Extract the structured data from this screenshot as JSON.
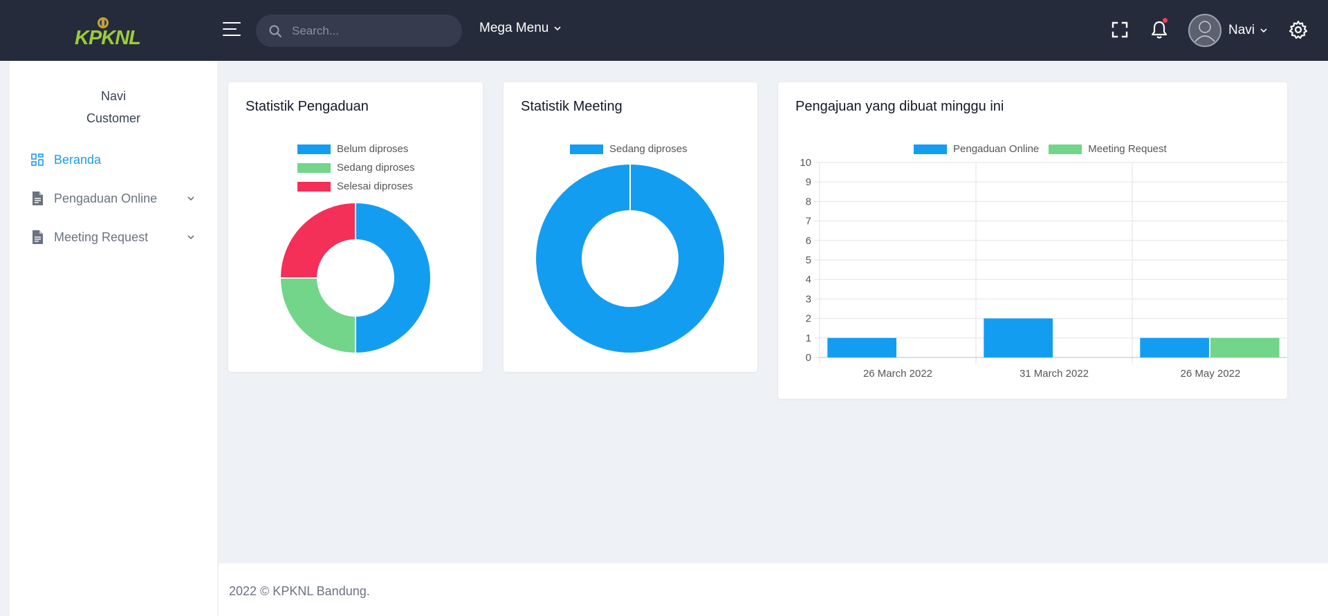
{
  "header": {
    "logo_text": "KPKNL",
    "search": {
      "placeholder": "Search..."
    },
    "mega_menu_label": "Mega Menu",
    "user_name": "Navi"
  },
  "sidebar": {
    "user_name": "Navi",
    "user_role": "Customer",
    "items": [
      {
        "label": "Beranda",
        "active": true,
        "icon": "dashboard-icon"
      },
      {
        "label": "Pengaduan Online",
        "active": false,
        "icon": "document-icon",
        "expandable": true
      },
      {
        "label": "Meeting Request",
        "active": false,
        "icon": "document-icon",
        "expandable": true
      }
    ]
  },
  "cards": {
    "pengaduan": {
      "title": "Statistik Pengaduan",
      "legend": [
        "Belum diproses",
        "Sedang diproses",
        "Selesai diproses"
      ]
    },
    "meeting": {
      "title": "Statistik Meeting",
      "legend": [
        "Sedang diproses"
      ]
    },
    "weekly": {
      "title": "Pengajuan yang dibuat minggu ini",
      "legend": [
        "Pengaduan Online",
        "Meeting Request"
      ]
    }
  },
  "colors": {
    "blue": "#139df0",
    "green": "#72d58a",
    "red": "#f42f58",
    "active_nav": "#1a9ce8",
    "header_bg": "#252b3b"
  },
  "chart_data": [
    {
      "type": "pie",
      "donut": true,
      "title": "Statistik Pengaduan",
      "categories": [
        "Belum diproses",
        "Sedang diproses",
        "Selesai diproses"
      ],
      "values": [
        2,
        1,
        1
      ],
      "colors": [
        "#139df0",
        "#72d58a",
        "#f42f58"
      ],
      "legend": "top"
    },
    {
      "type": "pie",
      "donut": true,
      "title": "Statistik Meeting",
      "categories": [
        "Sedang diproses"
      ],
      "values": [
        1
      ],
      "colors": [
        "#139df0"
      ],
      "legend": "top"
    },
    {
      "type": "bar",
      "title": "Pengajuan yang dibuat minggu ini",
      "categories": [
        "26 March 2022",
        "31 March 2022",
        "26 May 2022"
      ],
      "series": [
        {
          "name": "Pengaduan Online",
          "values": [
            1,
            2,
            1
          ],
          "color": "#139df0"
        },
        {
          "name": "Meeting Request",
          "values": [
            0,
            0,
            1
          ],
          "color": "#72d58a"
        }
      ],
      "ylim": [
        0,
        10
      ],
      "yticks": [
        0,
        1,
        2,
        3,
        4,
        5,
        6,
        7,
        8,
        9,
        10
      ],
      "grid": true,
      "legend": "top"
    }
  ],
  "footer": {
    "text": "2022 © KPKNL Bandung."
  }
}
